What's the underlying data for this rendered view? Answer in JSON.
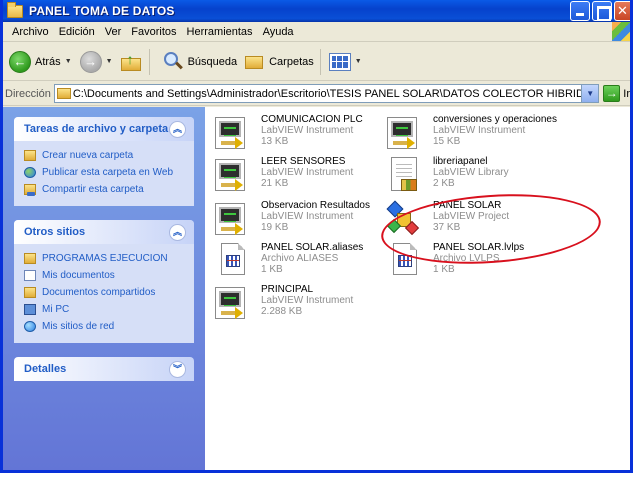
{
  "window": {
    "title": "PANEL TOMA DE DATOS"
  },
  "menu": [
    "Archivo",
    "Edición",
    "Ver",
    "Favoritos",
    "Herramientas",
    "Ayuda"
  ],
  "toolbar": {
    "back_label": "Atrás",
    "search_label": "Búsqueda",
    "folders_label": "Carpetas"
  },
  "address": {
    "label": "Dirección",
    "value": "C:\\Documents and Settings\\Administrador\\Escritorio\\TESIS PANEL SOLAR\\DATOS COLECTOR HIBRIDO FR\\PROGRAMAS EJECUCION\\",
    "go_label": "Ir"
  },
  "tasks": {
    "file_tasks": {
      "title": "Tareas de archivo y carpeta",
      "links": [
        "Crear nueva carpeta",
        "Publicar esta carpeta en Web",
        "Compartir esta carpeta"
      ]
    },
    "other_places": {
      "title": "Otros sitios",
      "links": [
        "PROGRAMAS EJECUCION",
        "Mis documentos",
        "Documentos compartidos",
        "Mi PC",
        "Mis sitios de red"
      ]
    },
    "details": {
      "title": "Detalles"
    }
  },
  "files": [
    {
      "name": "COMUNICACION PLC",
      "type": "LabVIEW Instrument",
      "size": "13 KB",
      "icon": "labview-vi-icon"
    },
    {
      "name": "conversiones y operaciones",
      "type": "LabVIEW Instrument",
      "size": "15 KB",
      "icon": "labview-vi-icon"
    },
    {
      "name": "LEER SENSORES",
      "type": "LabVIEW Instrument",
      "size": "21 KB",
      "icon": "labview-vi-icon"
    },
    {
      "name": "libreriapanel",
      "type": "LabVIEW Library",
      "size": "2 KB",
      "icon": "labview-library-icon"
    },
    {
      "name": "Observacion Resultados",
      "type": "LabVIEW Instrument",
      "size": "19 KB",
      "icon": "labview-vi-icon"
    },
    {
      "name": "PANEL SOLAR",
      "type": "LabVIEW Project",
      "size": "37 KB",
      "icon": "labview-project-icon"
    },
    {
      "name": "PANEL SOLAR.aliases",
      "type": "Archivo ALIASES",
      "size": "1 KB",
      "icon": "generic-document-icon"
    },
    {
      "name": "PANEL SOLAR.lvlps",
      "type": "Archivo LVLPS",
      "size": "1 KB",
      "icon": "generic-document-icon"
    },
    {
      "name": "PRINCIPAL",
      "type": "LabVIEW Instrument",
      "size": "2.288 KB",
      "icon": "labview-vi-icon"
    }
  ],
  "colors": {
    "title_bar": "#0a5ae6",
    "task_link": "#215dc6",
    "highlight_ellipse": "#d8101d"
  }
}
